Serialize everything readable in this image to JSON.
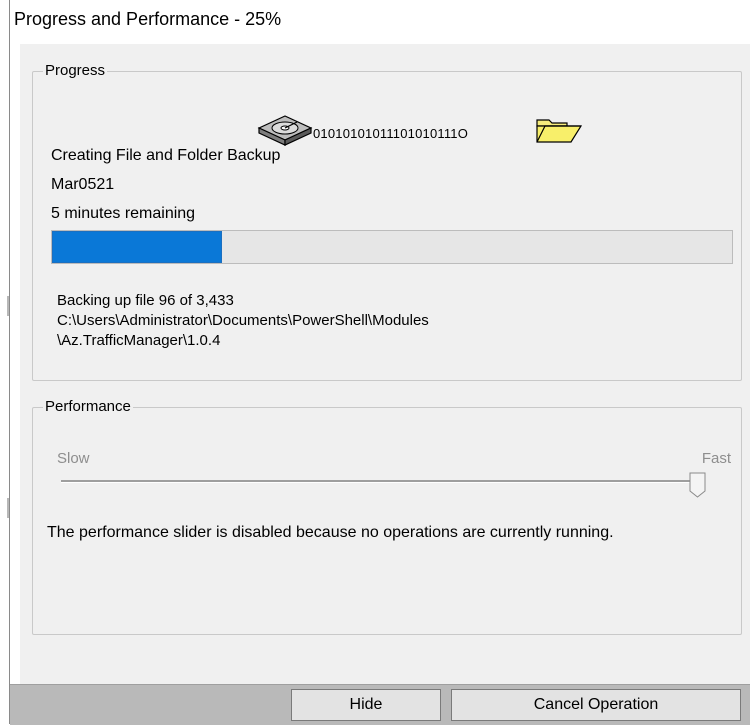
{
  "window": {
    "title": "Progress and Performance - 25%"
  },
  "progress": {
    "group_label": "Progress",
    "animation": {
      "source_icon": "disk-drive-icon",
      "bits": "01010101011101010111O",
      "target_icon": "folder-icon"
    },
    "operation": "Creating File and Folder Backup",
    "backup_name": "Mar0521",
    "time_remaining": "5 minutes remaining",
    "percent": 25,
    "file_status": "Backing up file 96 of 3,433",
    "file_path_line1": "C:\\Users\\Administrator\\Documents\\PowerShell\\Modules",
    "file_path_line2": "\\Az.TrafficManager\\1.0.4"
  },
  "performance": {
    "group_label": "Performance",
    "slider_min_label": "Slow",
    "slider_max_label": "Fast",
    "slider_value": 1.0,
    "slider_enabled": false,
    "note": "The performance slider is disabled because no operations are currently running."
  },
  "footer": {
    "hide_label": "Hide",
    "cancel_label": "Cancel Operation"
  },
  "colors": {
    "progress_fill": "#0a78d7",
    "dialog_bg": "#f0f0f0",
    "footer_bg": "#b9b9b9"
  }
}
